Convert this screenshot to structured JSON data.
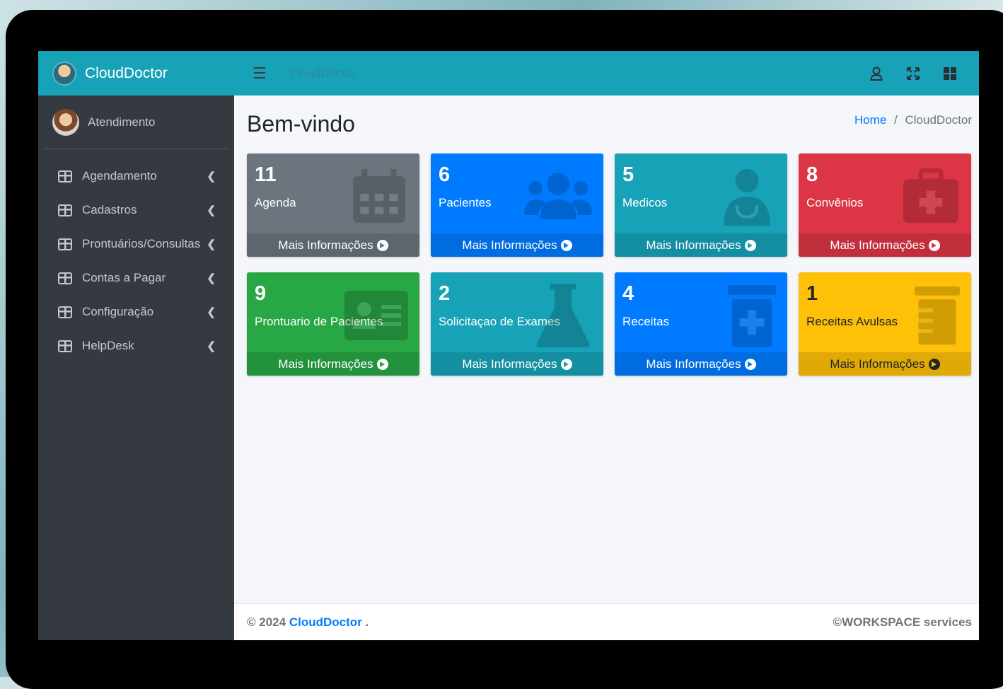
{
  "brand": {
    "name": "CloudDoctor",
    "logo": "doctor-avatar-logo"
  },
  "user": {
    "name": "Atendimento"
  },
  "sidebar": {
    "items": [
      {
        "label": "Agendamento",
        "icon": "table-icon"
      },
      {
        "label": "Cadastros",
        "icon": "table-icon"
      },
      {
        "label": "Prontuários/Consultas",
        "icon": "table-icon"
      },
      {
        "label": "Contas a Pagar",
        "icon": "table-icon"
      },
      {
        "label": "Configuração",
        "icon": "table-icon"
      },
      {
        "label": "HelpDesk",
        "icon": "table-icon"
      }
    ]
  },
  "topbar": {
    "title": "CloudDoctor",
    "icons": [
      "menu-icon",
      "user-icon",
      "expand-icon",
      "apps-icon"
    ]
  },
  "content": {
    "title": "Bem-vindo",
    "breadcrumb": {
      "home": "Home",
      "separator": "/",
      "current": "CloudDoctor"
    }
  },
  "cards": [
    {
      "count": "11",
      "label": "Agenda",
      "more": "Mais Informações",
      "color": "#6c757d",
      "icon": "calendar-icon"
    },
    {
      "count": "6",
      "label": "Pacientes",
      "more": "Mais Informações",
      "color": "#007bff",
      "icon": "users-icon"
    },
    {
      "count": "5",
      "label": "Medicos",
      "more": "Mais Informações",
      "color": "#17a2b8",
      "icon": "doctor-icon"
    },
    {
      "count": "8",
      "label": "Convênios",
      "more": "Mais Informações",
      "color": "#dc3545",
      "icon": "medical-kit-icon"
    },
    {
      "count": "9",
      "label": "Prontuario de Pacientes",
      "more": "Mais Informações",
      "color": "#28a745",
      "icon": "id-card-icon"
    },
    {
      "count": "2",
      "label": "Solicitaçao de Exames",
      "more": "Mais Informações",
      "color": "#17a2b8",
      "icon": "flask-icon"
    },
    {
      "count": "4",
      "label": "Receitas",
      "more": "Mais Informações",
      "color": "#007bff",
      "icon": "prescription-bottle-icon"
    },
    {
      "count": "1",
      "label": "Receitas Avulsas",
      "more": "Mais Informações",
      "color": "#ffc107",
      "icon": "pill-bottle-icon"
    }
  ],
  "footer": {
    "copyright": "© 2024",
    "brand": "CloudDoctor",
    "suffix": ".",
    "right": "©WORKSPACE services"
  }
}
